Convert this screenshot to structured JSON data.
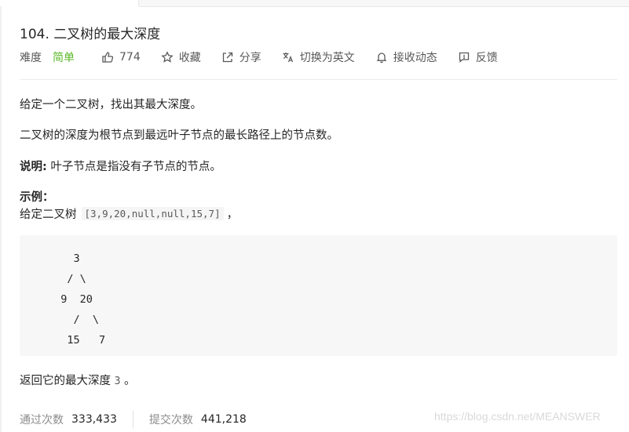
{
  "problem": {
    "title": "104. 二叉树的最大深度",
    "difficulty_label": "难度",
    "difficulty_value": "简单",
    "likes": "774",
    "favorite_label": "收藏",
    "share_label": "分享",
    "switch_lang_label": "切换为英文",
    "subscribe_label": "接收动态",
    "feedback_label": "反馈"
  },
  "description": {
    "p1": "给定一个二叉树，找出其最大深度。",
    "p2": "二叉树的深度为根节点到最远叶子节点的最长路径上的节点数。",
    "note_label": "说明:",
    "note_text": " 叶子节点是指没有子节点的节点。",
    "example_heading": "示例：",
    "example_prefix": "给定二叉树",
    "example_input": "[3,9,20,null,null,15,7]",
    "example_suffix": "，",
    "tree_ascii": "    3\n   / \\\n  9  20\n    /  \\\n   15   7",
    "result_prefix": "返回它的最大深度 ",
    "result_value": "3",
    "result_suffix": " 。"
  },
  "stats": {
    "accepted_label": "通过次数",
    "accepted_value": "333,433",
    "submitted_label": "提交次数",
    "submitted_value": "441,218"
  },
  "watermark": "https://blog.csdn.net/MEANSWER",
  "icons": {
    "like": "thumbs-up-icon",
    "favorite": "star-icon",
    "share": "share-icon",
    "switch_lang": "translate-icon",
    "subscribe": "bell-icon",
    "feedback": "feedback-icon"
  },
  "colors": {
    "difficulty_easy": "#5ab726",
    "text": "#262626",
    "muted": "#8c8c8c",
    "code_bg": "#f7f7f7"
  }
}
